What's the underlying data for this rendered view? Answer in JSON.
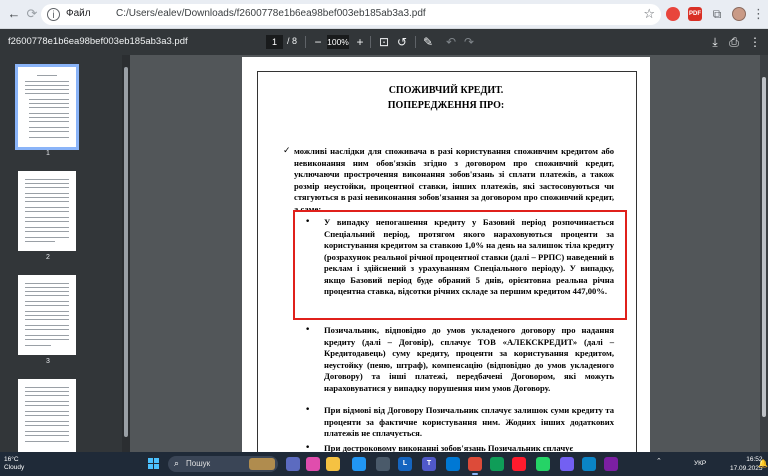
{
  "browser": {
    "scheme_label": "Файл",
    "url": "C:/Users/ealev/Downloads/f2600778e1b6ea98bef003eb185ab3a3.pdf",
    "back_icon": "arrow-left-icon",
    "forward_icon": "arrow-right-icon",
    "reload_icon": "reload-icon",
    "star_icon": "star-icon"
  },
  "toolbar": {
    "file_name": "f2600778e1b6ea98bef003eb185ab3a3.pdf",
    "current_page": "1",
    "page_separator": "/ 8",
    "zoom_out": "−",
    "zoom_value": "100%",
    "zoom_in": "+"
  },
  "thumbnails": [
    {
      "num": "1",
      "active": true
    },
    {
      "num": "2",
      "active": false
    },
    {
      "num": "3",
      "active": false
    },
    {
      "num": "",
      "active": false
    }
  ],
  "document": {
    "heading_line1": "СПОЖИВЧИЙ КРЕДИТ.",
    "heading_line2": "ПОПЕРЕДЖЕННЯ ПРО:",
    "check_mark": "✓",
    "intro": "можливі наслідки для споживача в разі користування споживчим кредитом або невиконання ним обов'язків згідно з договором про споживчий кредит, уключаючи прострочення виконання зобов'язань зі сплати платежів, а також розмір неустойки, процентної ставки, інших платежів, які застосовуються чи стягуються в разі невиконання зобов'язання за договором про споживчий кредит, а саме:",
    "bullet_mark": "•",
    "bullet1": "У випадку непогашення кредиту у Базовий період розпочинається Спеціальний період, протягом якого нараховуються проценти за користування кредитом за ставкою 1,0% на день на залишок тіла кредиту (розрахунок реальної річної процентної ставки (далі – РРПС) наведений в реклам і здійснений з урахуванням Спеціального періоду). У випадку, якщо Базовий період буде обраний 5 днів, орієнтовна реальна річна процентна ставка, відсотки річних складе за першим кредитом 447,00%.",
    "bullet2": "Позичальник, відповідно до умов укладеного договору про надання кредиту (далі – Договір), сплачує ТОВ «АЛЕКСКРЕДИТ» (далі – Кредитодавець) суму кредиту, проценти за користування кредитом, неустойку (пеню, штраф), компенсацію (відповідно до умов укладеного Договору) та інші платежі, передбачені Договором, які можуть нараховуватися у випадку порушення ним умов Договору.",
    "bullet3": "При відмові від Договору Позичальник сплачує залишок суми кредиту та проценти за фактичне користування ним. Жодних інших додаткових платежів не сплачується.",
    "bullet4": "При достроковому виконанні зобов'язань Позичальник сплачує"
  },
  "taskbar": {
    "temperature": "16°C",
    "weather": "Cloudy",
    "search_label": "Пошук",
    "language": "УКР",
    "time": "16:52",
    "date": "17.09.2025"
  },
  "colors": {
    "highlight_border": "#e0201b",
    "viewer_bg": "#525659",
    "toolbar_bg": "#323639",
    "accent": "#8ab4f8"
  }
}
